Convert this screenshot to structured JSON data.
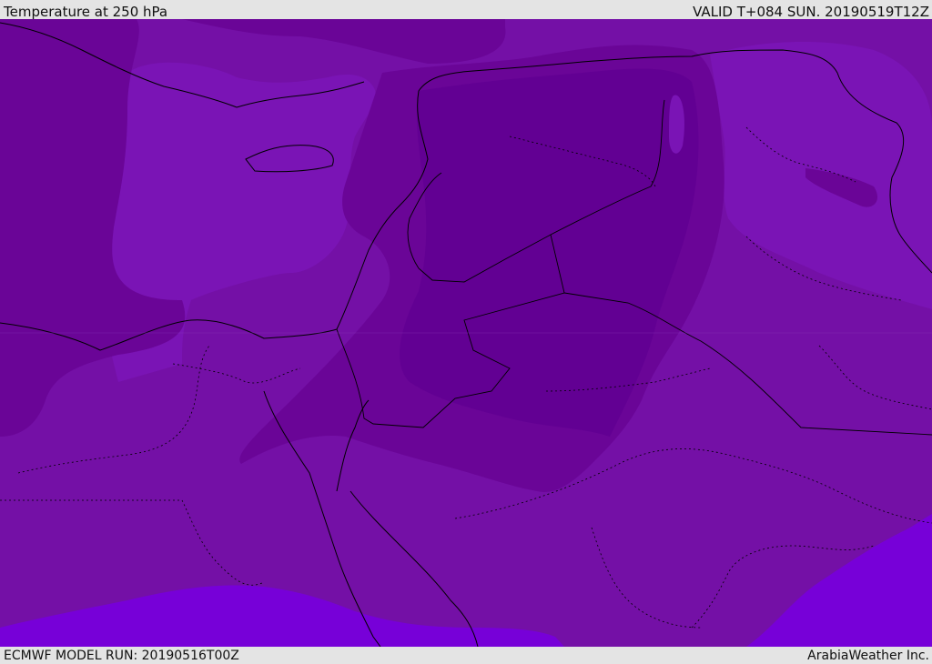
{
  "header": {
    "title": "Temperature at 250 hPa",
    "valid_time": "VALID T+084 SUN. 20190519T12Z"
  },
  "footer": {
    "model_run": "ECMWF MODEL RUN: 20190516T00Z",
    "credit": "ArabiaWeather Inc."
  },
  "colors": {
    "warmest": "#7700d8",
    "warm": "#7a14b5",
    "mid": "#7410a6",
    "cold": "#6a0597",
    "coldest": "#620093",
    "border": "#000000"
  },
  "map": {
    "variable": "temperature",
    "level": "250 hPa",
    "region": "Eastern Mediterranean and Middle East"
  }
}
